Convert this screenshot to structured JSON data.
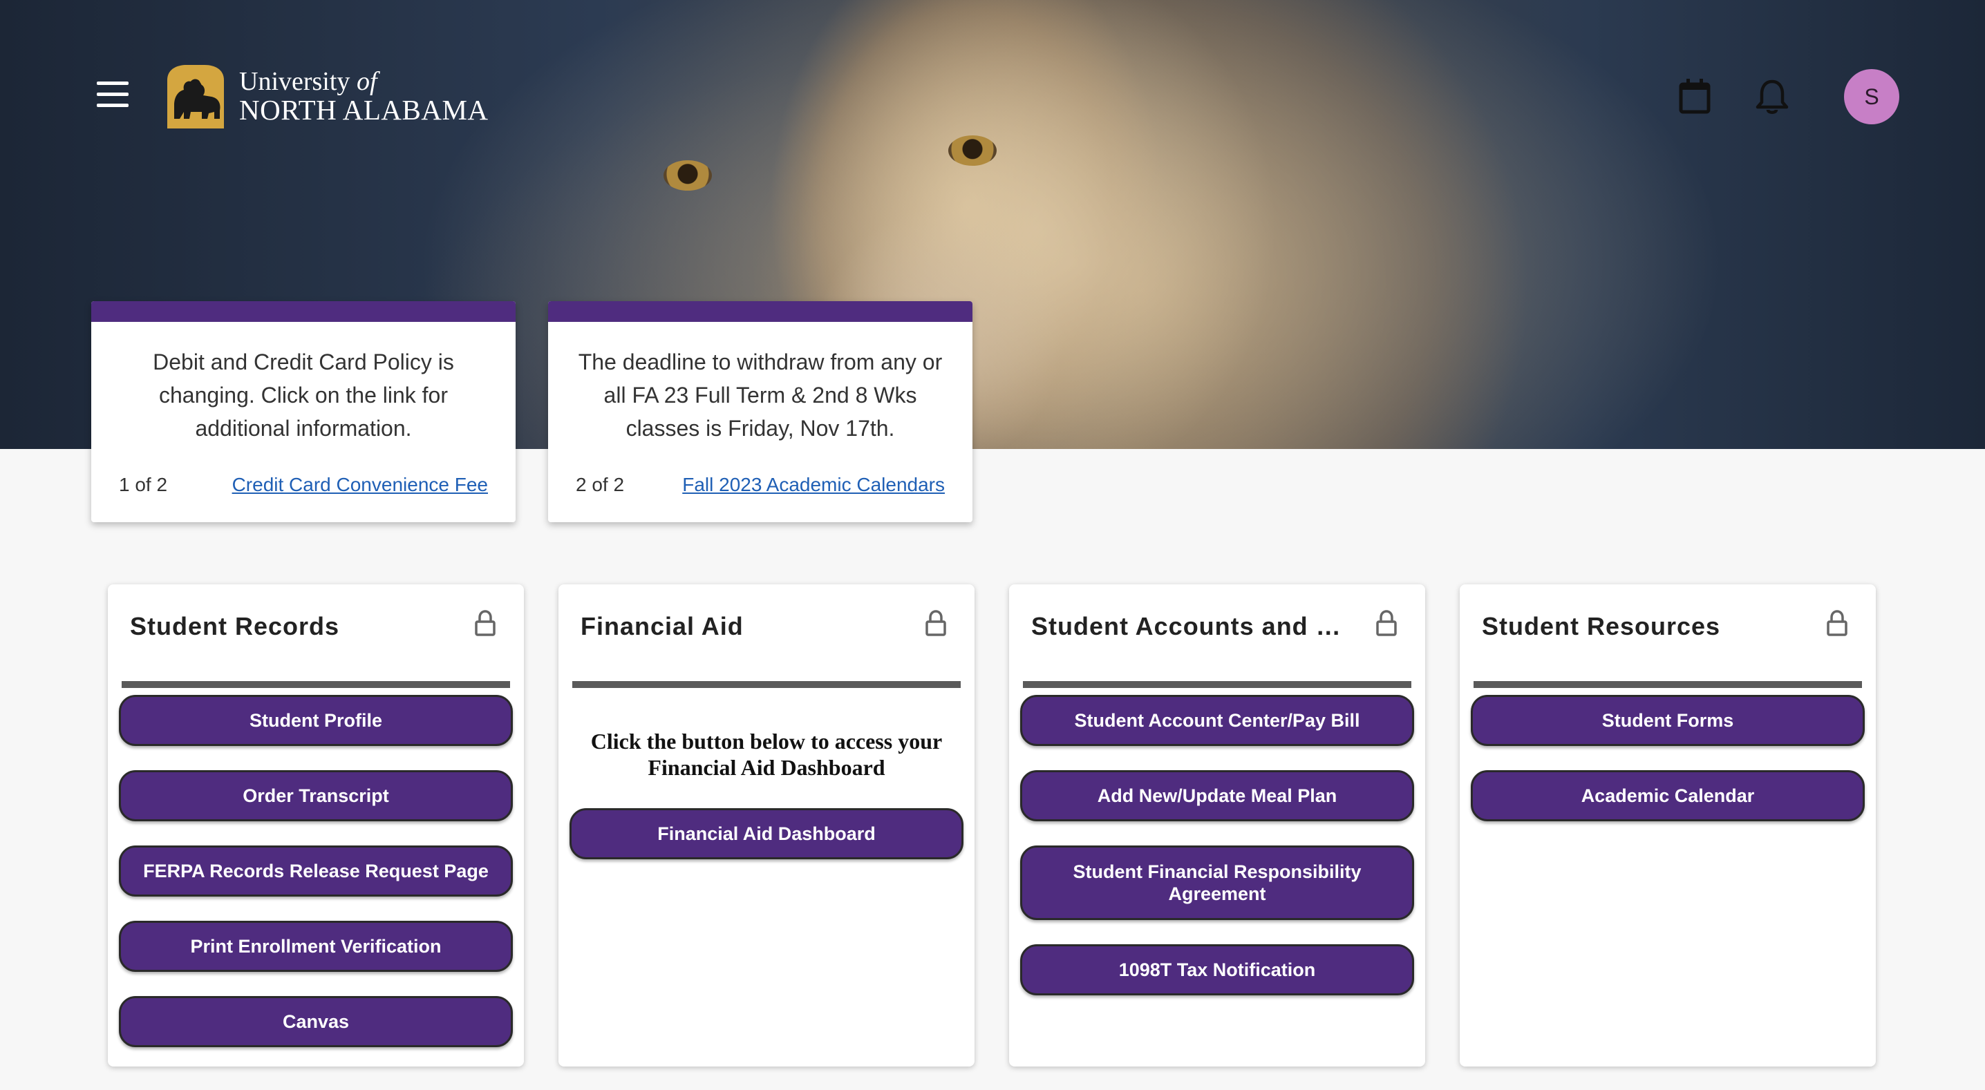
{
  "header": {
    "logo_line1_prefix": "University ",
    "logo_line1_suffix": "of",
    "logo_line2": "NORTH ALABAMA",
    "avatar_initial": "S",
    "icons": [
      "menu-icon",
      "calendar-icon",
      "bell-icon"
    ]
  },
  "announcements": [
    {
      "message": "Debit and Credit Card Policy is changing. Click on the link for additional information.",
      "counter": "1 of 2",
      "link": "Credit Card Convenience Fee"
    },
    {
      "message": "The deadline to withdraw from any or all FA 23 Full Term & 2nd 8 Wks classes is Friday, Nov 17th.",
      "counter": "2 of 2",
      "link": "Fall 2023 Academic Calendars"
    }
  ],
  "cards": {
    "student_records": {
      "title": "Student Records",
      "buttons": [
        "Student Profile",
        "Order Transcript",
        "FERPA Records Release Request Page",
        "Print Enrollment Verification",
        "Canvas"
      ]
    },
    "financial_aid": {
      "title": "Financial Aid",
      "instruction": "Click the button below to access your Financial Aid Dashboard",
      "buttons": [
        "Financial Aid Dashboard"
      ]
    },
    "student_accounts": {
      "title": "Student Accounts and M...",
      "buttons": [
        "Student Account Center/Pay Bill",
        "Add New/Update Meal Plan",
        "Student Financial Responsibility Agreement",
        "1098T Tax Notification"
      ]
    },
    "student_resources": {
      "title": "Student Resources",
      "buttons": [
        "Student Forms",
        "Academic Calendar"
      ]
    }
  },
  "colors": {
    "brand_purple": "#4f2c7f",
    "logo_gold": "#d4a640",
    "avatar": "#c77fc6",
    "link": "#1f5fb5"
  }
}
